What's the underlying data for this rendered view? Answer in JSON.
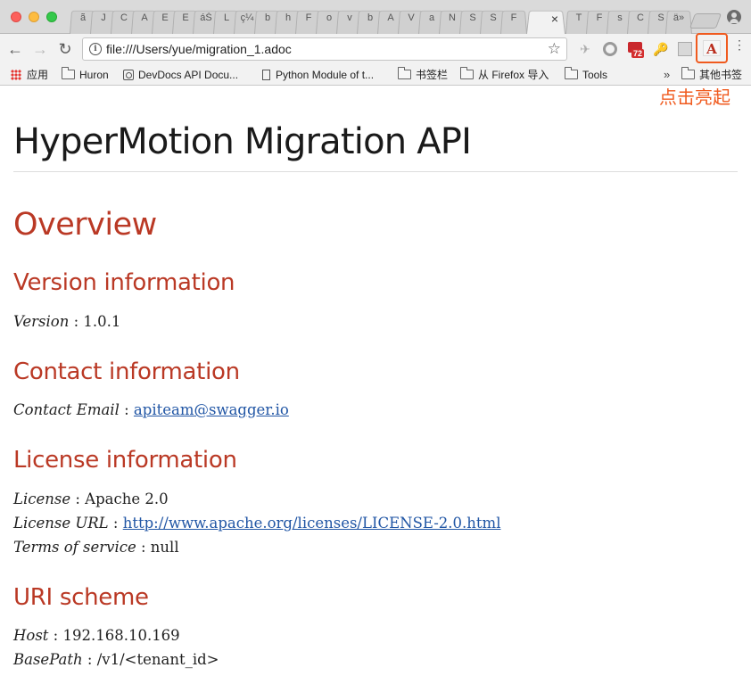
{
  "browser": {
    "tabs": [
      {
        "label": "ã"
      },
      {
        "label": "J"
      },
      {
        "label": "C"
      },
      {
        "label": "A"
      },
      {
        "label": "E"
      },
      {
        "label": "E"
      },
      {
        "label": "áŠ"
      },
      {
        "label": "L"
      },
      {
        "label": "ç¼"
      },
      {
        "label": "b"
      },
      {
        "label": "h"
      },
      {
        "label": "F"
      },
      {
        "label": "o"
      },
      {
        "label": "v"
      },
      {
        "label": "b"
      },
      {
        "label": "A"
      },
      {
        "label": "V"
      },
      {
        "label": "a"
      },
      {
        "label": "N"
      },
      {
        "label": "S"
      },
      {
        "label": "S"
      },
      {
        "label": "F"
      }
    ],
    "active_tab": {
      "close": "×"
    },
    "tabs_after": [
      {
        "label": "T"
      },
      {
        "label": "F"
      },
      {
        "label": "s"
      },
      {
        "label": "C"
      },
      {
        "label": "S"
      },
      {
        "label": "ä»"
      }
    ],
    "url": "file:///Users/yue/migration_1.adoc",
    "back": "←",
    "forward": "→",
    "reload": "↻",
    "star": "☆",
    "extension_badge": "72",
    "asciidoc_ext_letter": "A",
    "menu": "⋮"
  },
  "bookmarks": {
    "apps": "应用",
    "items": [
      {
        "label": "Huron"
      },
      {
        "label": "DevDocs API Docu..."
      },
      {
        "label": "Python Module of t..."
      },
      {
        "label": "书签栏"
      },
      {
        "label": "从 Firefox 导入"
      },
      {
        "label": "Tools"
      }
    ],
    "more": "»",
    "other": "其他书签"
  },
  "annotation": "点击亮起",
  "doc": {
    "title": "HyperMotion Migration API",
    "overview": "Overview",
    "version_heading": "Version information",
    "version_label": "Version",
    "version_value": " : 1.0.1",
    "contact_heading": "Contact information",
    "contact_label": "Contact Email",
    "contact_sep": " : ",
    "contact_email": "apiteam@swagger.io",
    "license_heading": "License information",
    "license_label": "License",
    "license_value": " : Apache 2.0",
    "license_url_label": "License URL",
    "license_url_sep": " : ",
    "license_url": "http://www.apache.org/licenses/LICENSE-2.0.html",
    "terms_label": "Terms of service",
    "terms_value": " : null",
    "uri_heading": "URI scheme",
    "host_label": "Host",
    "host_value": " : 192.168.10.169",
    "basepath_label": "BasePath",
    "basepath_value": " : /v1/<tenant_id>"
  }
}
